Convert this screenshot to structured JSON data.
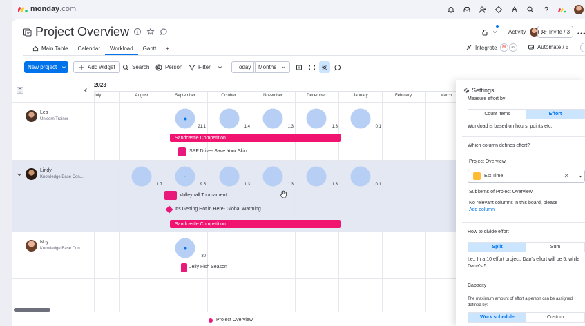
{
  "app": {
    "brand": "monday",
    "brand_suffix": ".com"
  },
  "board": {
    "title": "Project Overview",
    "tabs": [
      {
        "label": "Main Table"
      },
      {
        "label": "Calendar"
      },
      {
        "label": "Workload"
      },
      {
        "label": "Gantt"
      },
      {
        "label": "+"
      }
    ],
    "activity_label": "Activity",
    "invite_label": "Invite / 3",
    "integrate_label": "Integrate",
    "automate_label": "Automate / 5"
  },
  "toolbar": {
    "new_project": "New project",
    "add_widget": "Add widget",
    "search": "Search",
    "person": "Person",
    "filter": "Filter",
    "today": "Today",
    "zoom": "Months"
  },
  "timeline": {
    "year": "2023",
    "months": [
      "July",
      "August",
      "September",
      "October",
      "November",
      "December",
      "January",
      "February",
      "March"
    ]
  },
  "people": [
    {
      "name": "Lea",
      "role": "Unicorn Trainer",
      "workload": [
        "21.1",
        "1.4",
        "1.3",
        "1.3",
        "0.1"
      ],
      "items": [
        "Sandcastle Competition",
        "SPF Drive- Save Your Skin"
      ]
    },
    {
      "name": "Lindy",
      "role": "Knowledge Base Con...",
      "workload": [
        "1.7",
        "9.5",
        "1.3",
        "1.3",
        "1.3",
        "0.1"
      ],
      "items": [
        "Volleyball Tournament",
        "It's Getting Hot in Here- Global Warming",
        "Sandcastle Competition"
      ]
    },
    {
      "name": "Noy",
      "role": "Knowledge Base Con...",
      "workload": [
        "30"
      ],
      "items": [
        "Jelly Fish Season"
      ]
    }
  ],
  "settings": {
    "title": "Settings",
    "measure_label": "Measure effort by",
    "measure_options": [
      "Count items",
      "Effort"
    ],
    "measure_note": "Workload is based on hours, points etc.",
    "column_question": "Which column defines effort?",
    "board_name": "Project Overview",
    "column_value": "Est Time",
    "subitems_label": "Subitems of Project Overview",
    "subitems_note": "No relevant columns in this board, please",
    "add_column": "Add column",
    "divide_label": "How to divide effort",
    "divide_options": [
      "Split",
      "Sum"
    ],
    "divide_note_1": "I.e., In a 10 effort project, Dan's effort will be 5, while",
    "divide_note_2": "Dana's 5",
    "capacity_label": "Capacity",
    "capacity_note_1": "The maximum amount of effort a person can be assigned",
    "capacity_note_2": "defined by:",
    "capacity_options": [
      "Work schedule",
      "Custom"
    ]
  },
  "legend": {
    "label": "Project Overview"
  },
  "colors": {
    "accent": "#0073ea",
    "item": "#f0136f",
    "circle": "#b8cff5",
    "selected_row": "#e4e8f3"
  }
}
